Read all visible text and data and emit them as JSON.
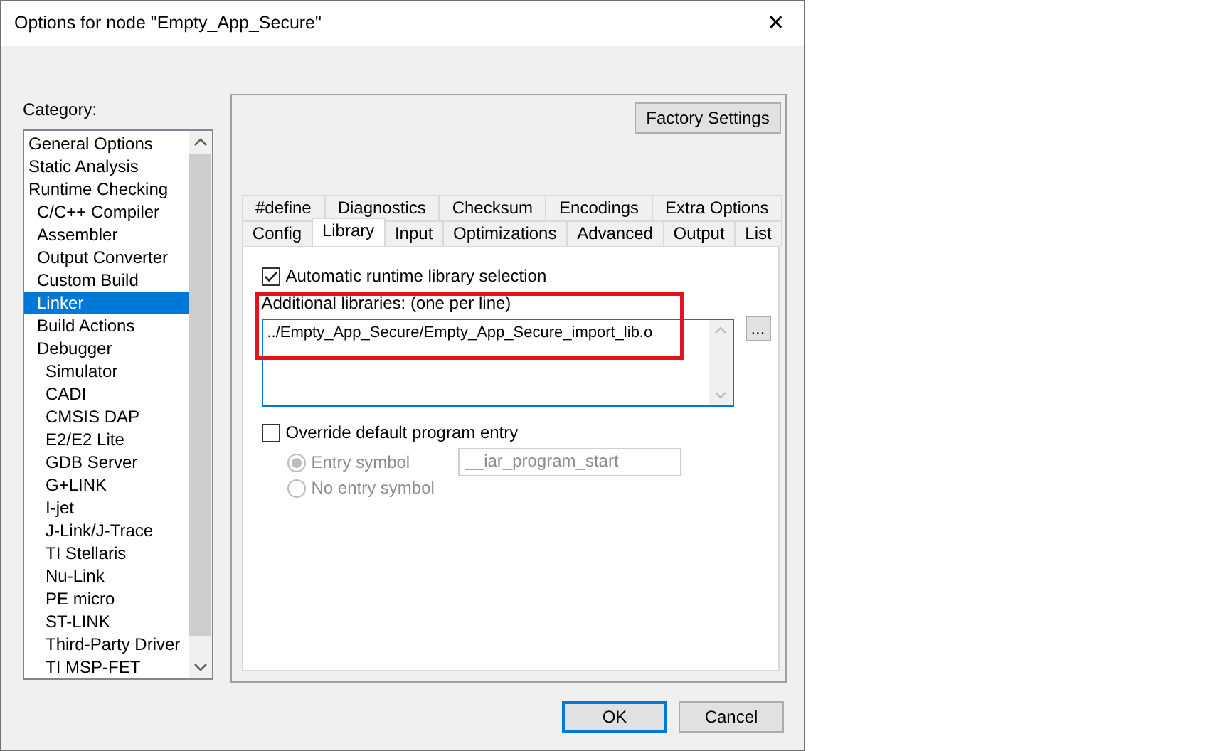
{
  "window": {
    "title": "Options for node \"Empty_App_Secure\"",
    "close": "✕"
  },
  "category": {
    "label": "Category:",
    "items": [
      {
        "label": "General Options",
        "selected": false
      },
      {
        "label": "Static Analysis",
        "selected": false
      },
      {
        "label": "Runtime Checking",
        "selected": false,
        "children": [
          {
            "label": "C/C++ Compiler",
            "selected": false
          },
          {
            "label": "Assembler",
            "selected": false
          },
          {
            "label": "Output Converter",
            "selected": false
          },
          {
            "label": "Custom Build",
            "selected": false
          },
          {
            "label": "Linker",
            "selected": true
          },
          {
            "label": "Build Actions",
            "selected": false
          },
          {
            "label": "Debugger",
            "selected": false,
            "children": [
              {
                "label": "Simulator",
                "selected": false
              },
              {
                "label": "CADI",
                "selected": false
              },
              {
                "label": "CMSIS DAP",
                "selected": false
              },
              {
                "label": "E2/E2 Lite",
                "selected": false
              },
              {
                "label": "GDB Server",
                "selected": false
              },
              {
                "label": "G+LINK",
                "selected": false
              },
              {
                "label": "I-jet",
                "selected": false
              },
              {
                "label": "J-Link/J-Trace",
                "selected": false
              },
              {
                "label": "TI Stellaris",
                "selected": false
              },
              {
                "label": "Nu-Link",
                "selected": false
              },
              {
                "label": "PE micro",
                "selected": false
              },
              {
                "label": "ST-LINK",
                "selected": false
              },
              {
                "label": "Third-Party Driver",
                "selected": false
              },
              {
                "label": "TI MSP-FET",
                "selected": false
              }
            ]
          }
        ]
      }
    ]
  },
  "factory_button": "Factory Settings",
  "tab_rows": [
    [
      {
        "label": "#define",
        "selected": false
      },
      {
        "label": "Diagnostics",
        "selected": false
      },
      {
        "label": "Checksum",
        "selected": false
      },
      {
        "label": "Encodings",
        "selected": false
      },
      {
        "label": "Extra Options",
        "selected": false
      }
    ],
    [
      {
        "label": "Config",
        "selected": false
      },
      {
        "label": "Library",
        "selected": true
      },
      {
        "label": "Input",
        "selected": false
      },
      {
        "label": "Optimizations",
        "selected": false
      },
      {
        "label": "Advanced",
        "selected": false
      },
      {
        "label": "Output",
        "selected": false
      },
      {
        "label": "List",
        "selected": false
      }
    ]
  ],
  "auto_library": {
    "label": "Automatic runtime library selection",
    "checked": true
  },
  "additional_libraries": {
    "label": "Additional libraries: (one per line)",
    "value": "../Empty_App_Secure/Empty_App_Secure_import_lib.o",
    "highlighted": true,
    "browse": "..."
  },
  "override_entry": {
    "label": "Override default program entry",
    "checked": false
  },
  "entry_options": [
    {
      "label": "Entry symbol",
      "selected": true,
      "disabled": true
    },
    {
      "label": "No entry symbol",
      "selected": false,
      "disabled": true
    }
  ],
  "entry_symbol": {
    "value": "__iar_program_start",
    "disabled": true
  },
  "buttons": [
    {
      "label": "OK",
      "default": true
    },
    {
      "label": "Cancel",
      "default": false
    }
  ]
}
